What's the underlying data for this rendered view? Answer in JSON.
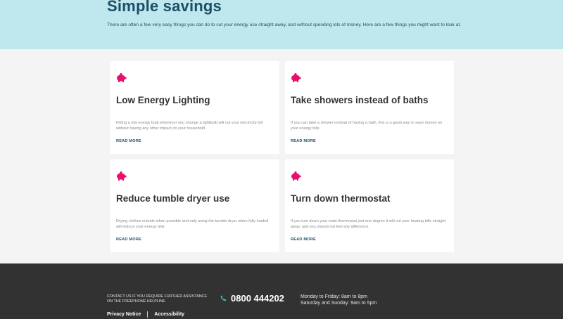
{
  "hero": {
    "title": "Simple savings",
    "text": "There are often a few very easy things you can do to cut your energy use straight away, and without spending lots of money. Here are a few things you might want to look at."
  },
  "colors": {
    "hero_bg": "#bfe8ee",
    "title": "#1c4f67",
    "pig": "#e8106c",
    "footer_bg": "#323232",
    "phone_icon": "#3fb6c9"
  },
  "cards": [
    {
      "icon": "piggy-bank-icon",
      "title": "Low Energy Lighting",
      "desc": "Fitting a low energy bulb whenever you change a lightbulb will cut your electricity bill without having any other impact on your household",
      "more": "READ MORE"
    },
    {
      "icon": "piggy-bank-icon",
      "title": "Take showers instead of baths",
      "desc": "If you can take a shower instead of having a bath, this is a great way to save money on your energy bills",
      "more": "READ MORE"
    },
    {
      "icon": "piggy-bank-icon",
      "title": "Reduce tumble dryer use",
      "desc": "Drying clothes outside when possible and only using the tumble dryer when fully loaded will reduce your energy bills",
      "more": "READ MORE"
    },
    {
      "icon": "piggy-bank-icon",
      "title": "Turn down thermostat",
      "desc": "If you turn down your main thermostat just one degree it will cut your heating bills straight away, and you should not feel any difference.",
      "more": "READ MORE"
    }
  ],
  "footer": {
    "assist": "CONTACT US IF YOU REQUIRE FURTHER ASSISTANCE ON THE FREEPHONE HELPLINE",
    "phone_icon": "phone-icon",
    "phone": "0800 444202",
    "hours_weekday": "Monday to Friday: 8am to 8pm",
    "hours_weekend": "Saturday and Sunday: 9am to 5pm",
    "privacy": "Privacy Notice",
    "accessibility": "Accessibility"
  }
}
